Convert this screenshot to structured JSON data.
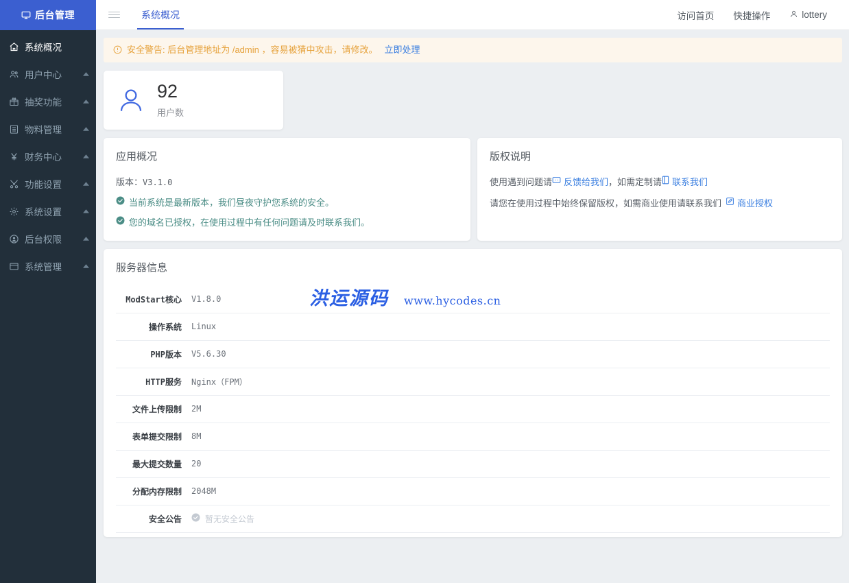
{
  "brand": {
    "title": "后台管理",
    "icon": "monitor-icon"
  },
  "sidebar": {
    "items": [
      {
        "label": "系统概况",
        "icon": "home-icon",
        "active": true,
        "expandable": false
      },
      {
        "label": "用户中心",
        "icon": "users-icon",
        "active": false,
        "expandable": true
      },
      {
        "label": "抽奖功能",
        "icon": "gift-icon",
        "active": false,
        "expandable": true
      },
      {
        "label": "物料管理",
        "icon": "list-icon",
        "active": false,
        "expandable": true
      },
      {
        "label": "财务中心",
        "icon": "yen-icon",
        "active": false,
        "expandable": true
      },
      {
        "label": "功能设置",
        "icon": "tools-icon",
        "active": false,
        "expandable": true
      },
      {
        "label": "系统设置",
        "icon": "gear-icon",
        "active": false,
        "expandable": true
      },
      {
        "label": "后台权限",
        "icon": "user-circle-icon",
        "active": false,
        "expandable": true
      },
      {
        "label": "系统管理",
        "icon": "window-icon",
        "active": false,
        "expandable": true
      }
    ]
  },
  "topbar": {
    "menu_icon": "hamburger-icon",
    "tabs": [
      {
        "label": "系统概况",
        "active": true
      }
    ],
    "nav": [
      {
        "label": "访问首页",
        "icon": ""
      },
      {
        "label": "快捷操作",
        "icon": ""
      },
      {
        "label": "lottery",
        "icon": "user-icon"
      }
    ]
  },
  "alert": {
    "icon": "warning-circle-icon",
    "text": "安全警告: 后台管理地址为 /admin ，容易被猜中攻击，请修改。",
    "link": "立即处理",
    "color": "#e6a23c",
    "link_color": "#3b7fe0",
    "bg": "#fdf6ec"
  },
  "stat_card": {
    "icon": "user-avatar-icon",
    "value": "92",
    "label": "用户数",
    "icon_color": "#4169e1"
  },
  "app_panel": {
    "title": "应用概况",
    "version_label": "版本：",
    "version_value": "V3.1.0",
    "checks": [
      {
        "icon": "check-circle-icon",
        "text": "当前系统是最新版本，我们昼夜守护您系统的安全。"
      },
      {
        "icon": "check-circle-icon",
        "text": "您的域名已授权，在使用过程中有任何问题请及时联系我们。"
      }
    ]
  },
  "copyright_panel": {
    "title": "版权说明",
    "line1_prefix": "使用遇到问题请",
    "line1_link1": "反馈给我们",
    "line1_link1_icon": "chat-icon",
    "line1_middle": "，如需定制请",
    "line1_link2": "联系我们",
    "line1_link2_icon": "book-icon",
    "line2_prefix": "请您在使用过程中始终保留版权，如需商业使用请联系我们",
    "line2_link": "商业授权",
    "line2_link_icon": "edit-square-icon"
  },
  "server_panel": {
    "title": "服务器信息",
    "rows": [
      {
        "key": "ModStart核心",
        "value": "V1.8.0",
        "muted": false
      },
      {
        "key": "操作系统",
        "value": "Linux",
        "muted": false
      },
      {
        "key": "PHP版本",
        "value": "V5.6.30",
        "muted": false
      },
      {
        "key": "HTTP服务",
        "value": "Nginx（FPM）",
        "muted": false
      },
      {
        "key": "文件上传限制",
        "value": "2M",
        "muted": false
      },
      {
        "key": "表单提交限制",
        "value": "8M",
        "muted": false
      },
      {
        "key": "最大提交数量",
        "value": "20",
        "muted": false
      },
      {
        "key": "分配内存限制",
        "value": "2048M",
        "muted": false
      },
      {
        "key": "安全公告",
        "value": "暂无安全公告",
        "muted": true,
        "icon": "check-circle-icon"
      }
    ]
  },
  "watermark": {
    "text": "洪运源码",
    "url": "www.hycodes.cn",
    "color": "#2b5fe3"
  },
  "colors": {
    "brand": "#3b5fd0",
    "sidebar_bg": "#222f3a",
    "content_bg": "#eceff2",
    "link": "#3b7fe0",
    "success": "#4b8d86",
    "warning": "#e6a23c"
  }
}
